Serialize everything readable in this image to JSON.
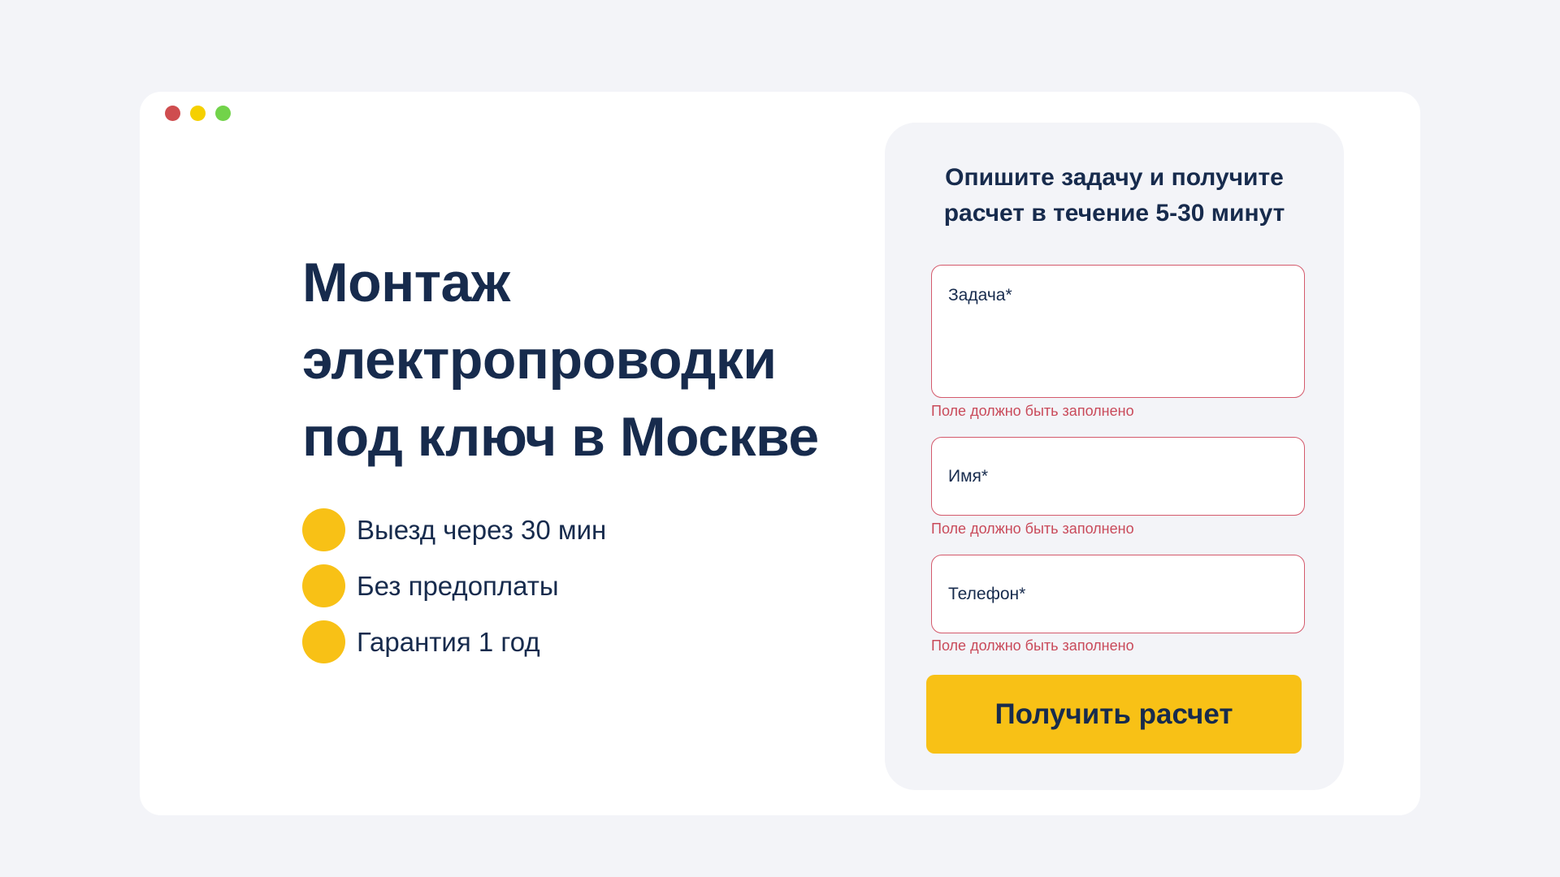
{
  "window": {
    "controls": [
      "close-dot",
      "minimize-dot",
      "maximize-dot"
    ]
  },
  "hero": {
    "title_line1": "Монтаж",
    "title_line2": "электропроводки",
    "title_line3": "под ключ в Москве",
    "features": [
      "Выезд через 30 мин",
      "Без предоплаты",
      "Гарантия 1 год"
    ]
  },
  "form": {
    "title_line1": "Опишите задачу и получите",
    "title_line2": "расчет в течение 5-30 минут",
    "task_placeholder": "Задача*",
    "name_placeholder": "Имя*",
    "phone_placeholder": "Телефон*",
    "error_text": "Поле должно быть заполнено",
    "submit_label": "Получить расчет"
  },
  "colors": {
    "background": "#f3f4f8",
    "text": "#172b4d",
    "accent": "#f8c116",
    "error": "#c94a5a"
  }
}
